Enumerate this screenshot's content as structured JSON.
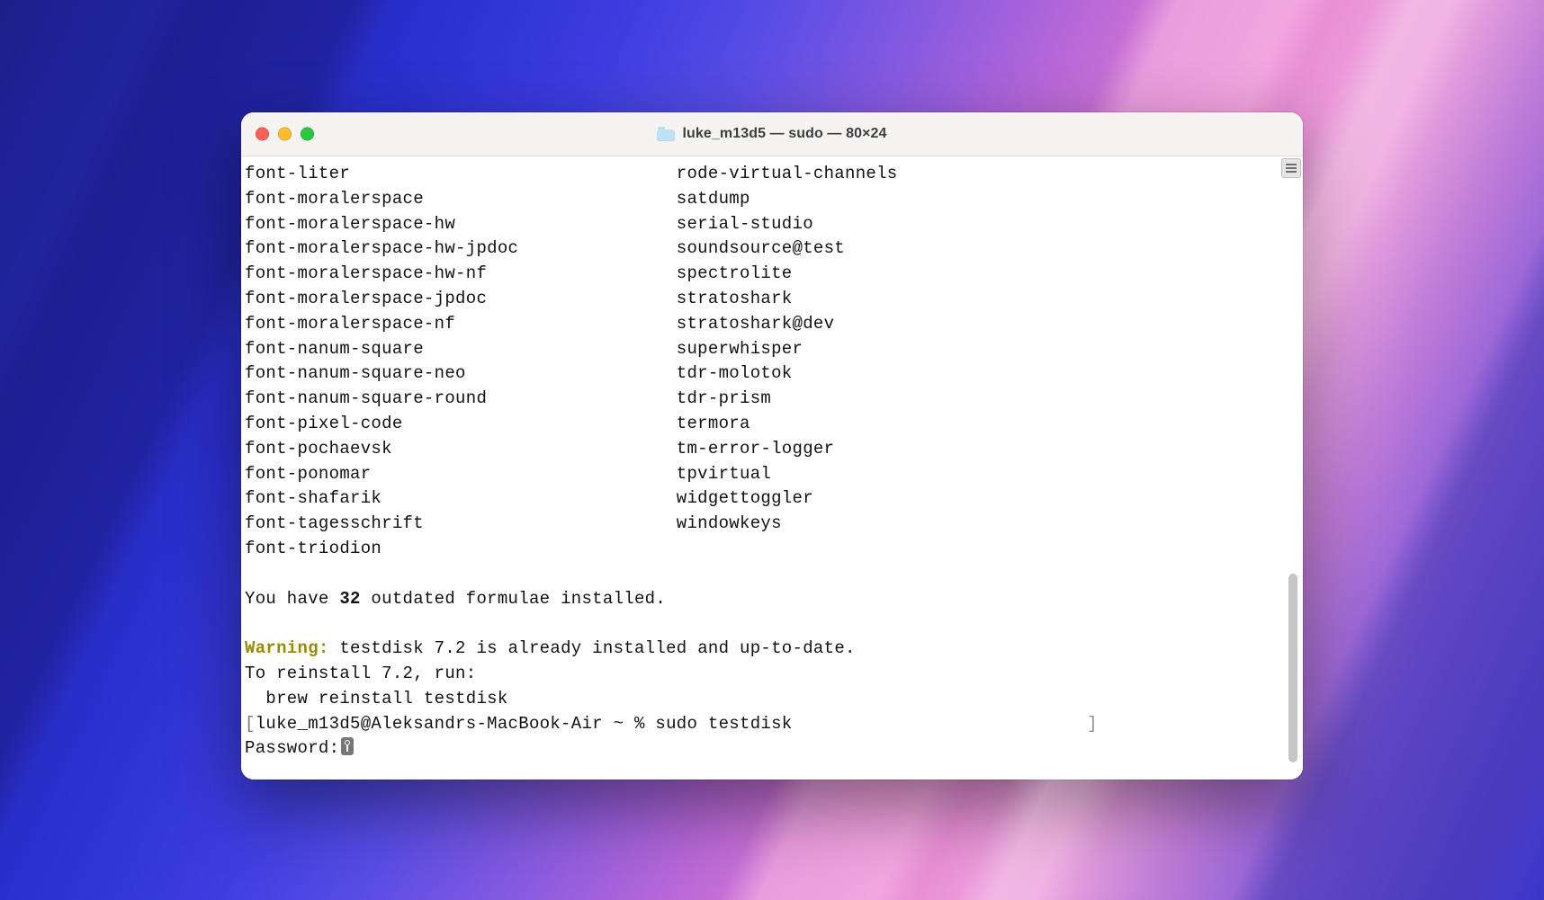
{
  "window": {
    "title": "luke_m13d5 — sudo — 80×24"
  },
  "columns": {
    "left": [
      "font-liter",
      "font-moralerspace",
      "font-moralerspace-hw",
      "font-moralerspace-hw-jpdoc",
      "font-moralerspace-hw-nf",
      "font-moralerspace-jpdoc",
      "font-moralerspace-nf",
      "font-nanum-square",
      "font-nanum-square-neo",
      "font-nanum-square-round",
      "font-pixel-code",
      "font-pochaevsk",
      "font-ponomar",
      "font-shafarik",
      "font-tagesschrift",
      "font-triodion"
    ],
    "right": [
      "rode-virtual-channels",
      "satdump",
      "serial-studio",
      "soundsource@test",
      "spectrolite",
      "stratoshark",
      "stratoshark@dev",
      "superwhisper",
      "tdr-molotok",
      "tdr-prism",
      "termora",
      "tm-error-logger",
      "tpvirtual",
      "widgettoggler",
      "windowkeys"
    ]
  },
  "outdated": {
    "prefix": "You have ",
    "count": "32",
    "suffix": " outdated formulae installed."
  },
  "warning": {
    "label": "Warning:",
    "message": " testdisk 7.2 is already installed and up-to-date."
  },
  "reinstall": {
    "line1": "To reinstall 7.2, run:",
    "line2": "  brew reinstall testdisk"
  },
  "prompt": {
    "open": "[",
    "user_host_path": "luke_m13d5@Aleksandrs-MacBook-Air ~ % ",
    "command": "sudo testdisk",
    "close_pad": "                                  ",
    "close": "]"
  },
  "password_label": "Password:"
}
